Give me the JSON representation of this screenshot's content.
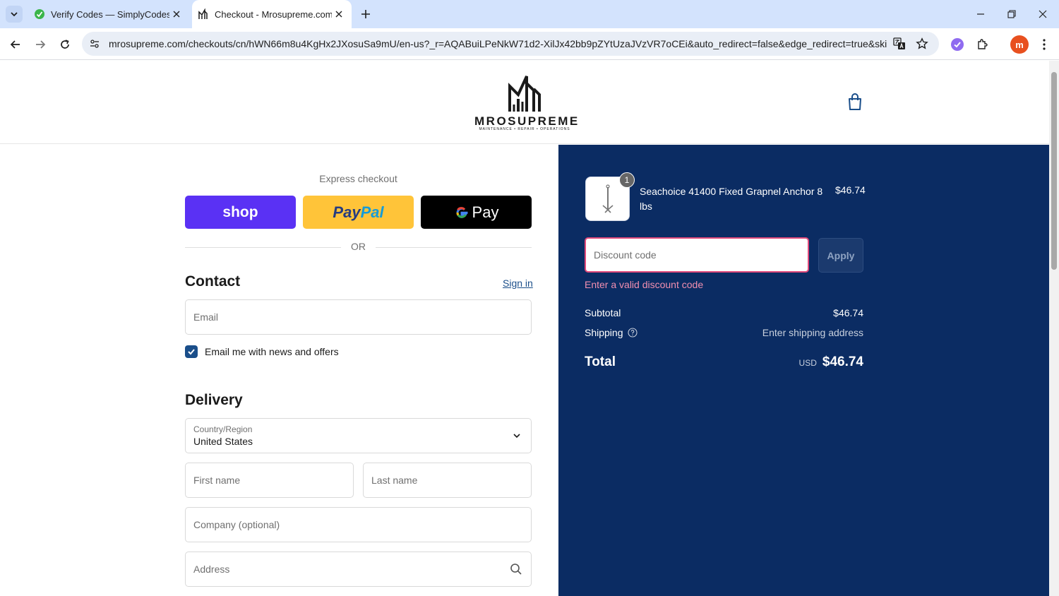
{
  "browser": {
    "tabs": [
      {
        "title": "Verify Codes — SimplyCodes",
        "active": false
      },
      {
        "title": "Checkout - Mrosupreme.com",
        "active": true
      }
    ],
    "url": "mrosupreme.com/checkouts/cn/hWN66m8u4KgHx2JXosuSa9mU/en-us?_r=AQABuiLPeNkW71d2-XilJx42bb9pZYtUzaJVzVR7oCEi&auto_redirect=false&edge_redirect=true&skip_sho...",
    "profile_initial": "m"
  },
  "header": {
    "logo_word": "MROSUPREME",
    "logo_tagline": "MAINTENANCE • REPAIR • OPERATIONS"
  },
  "checkout": {
    "express_label": "Express checkout",
    "shop_label": "shop",
    "paypal_part1": "Pay",
    "paypal_part2": "Pal",
    "gpay_label": "Pay",
    "or_label": "OR",
    "contact_title": "Contact",
    "signin_label": "Sign in",
    "email_placeholder": "Email",
    "newsletter_label": "Email me with news and offers",
    "newsletter_checked": true,
    "delivery_title": "Delivery",
    "country_label": "Country/Region",
    "country_value": "United States",
    "first_name_placeholder": "First name",
    "last_name_placeholder": "Last name",
    "company_placeholder": "Company (optional)",
    "address_placeholder": "Address"
  },
  "summary": {
    "item": {
      "quantity": "1",
      "name": "Seachoice 41400 Fixed Grapnel Anchor 8 lbs",
      "price": "$46.74"
    },
    "discount_placeholder": "Discount code",
    "apply_label": "Apply",
    "discount_error": "Enter a valid discount code",
    "subtotal_label": "Subtotal",
    "subtotal_value": "$46.74",
    "shipping_label": "Shipping",
    "shipping_value": "Enter shipping address",
    "total_label": "Total",
    "currency": "USD",
    "total_value": "$46.74"
  },
  "colors": {
    "summary_bg": "#0b2c63",
    "shop_pay": "#5a31f4",
    "paypal": "#ffc439",
    "error": "#e0497a",
    "link": "#1a4e8a"
  }
}
